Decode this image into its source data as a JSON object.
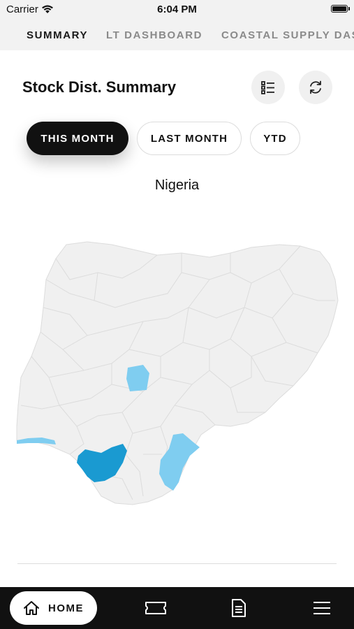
{
  "status_bar": {
    "carrier": "Carrier",
    "time": "6:04 PM"
  },
  "tabs": [
    {
      "label": "SUMMARY",
      "active": true
    },
    {
      "label": "LT DASHBOARD",
      "active": false
    },
    {
      "label": "COASTAL SUPPLY DASHBOARD",
      "active": false
    }
  ],
  "card": {
    "title": "Stock Dist. Summary",
    "actions": [
      "list-icon",
      "refresh-icon"
    ]
  },
  "filters": [
    {
      "label": "THIS MONTH",
      "selected": true
    },
    {
      "label": "LAST MONTH",
      "selected": false
    },
    {
      "label": "YTD",
      "selected": false
    }
  ],
  "map": {
    "title": "Nigeria",
    "colors": {
      "base": "#f0f0f0",
      "border": "#dcdcdc",
      "light": "#7fcdf0",
      "dark": "#1a9ad1"
    }
  },
  "bottom_nav": {
    "home_label": "HOME",
    "items": [
      "home-icon",
      "ticket-icon",
      "document-icon",
      "menu-icon"
    ]
  }
}
